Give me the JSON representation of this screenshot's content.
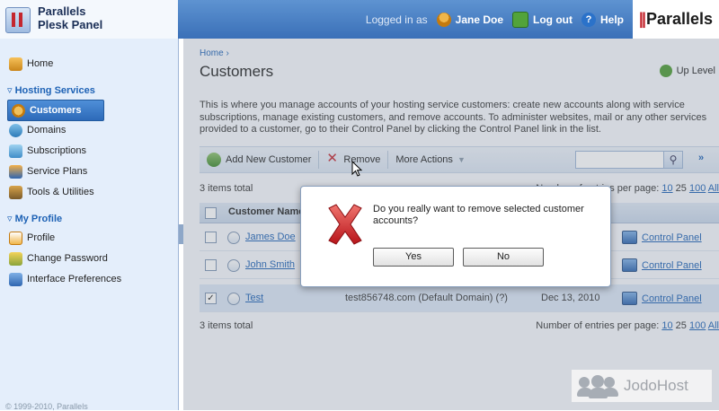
{
  "header": {
    "logo_line1": "Parallels",
    "logo_line2": "Plesk Panel",
    "logged_in_as": "Logged in as",
    "user_name": "Jane Doe",
    "logout": "Log out",
    "help": "Help",
    "brand": "Parallels",
    "brand_mark": "||"
  },
  "sidebar": {
    "home": "Home",
    "section_hosting": "Hosting Services",
    "items": [
      {
        "label": "Customers",
        "icon": "customers-icon"
      },
      {
        "label": "Domains",
        "icon": "domains-icon"
      },
      {
        "label": "Subscriptions",
        "icon": "subscriptions-icon"
      },
      {
        "label": "Service Plans",
        "icon": "service-plans-icon"
      },
      {
        "label": "Tools & Utilities",
        "icon": "tools-icon"
      }
    ],
    "section_profile": "My Profile",
    "profile_items": [
      {
        "label": "Profile",
        "icon": "profile-icon"
      },
      {
        "label": "Change Password",
        "icon": "key-icon"
      },
      {
        "label": "Interface Preferences",
        "icon": "interface-icon"
      }
    ],
    "copyright": "© 1999-2010, Parallels"
  },
  "main": {
    "breadcrumb": "Home ›",
    "title": "Customers",
    "up_level": "Up Level",
    "description": "This is where you manage accounts of your hosting service customers: create new accounts along with service subscriptions, manage existing customers, and remove accounts. To administer websites, mail or any other services provided to a customer, go to their Control Panel by clicking the Control Panel link in the list.",
    "toolbar": {
      "add_customer": "Add New Customer",
      "remove": "Remove",
      "more_actions": "More Actions",
      "search_placeholder": ""
    },
    "items_total": "3 items total",
    "per_page_label": "Number of entries per page:",
    "per_page_options": [
      "10",
      "25",
      "100",
      "All"
    ],
    "table": {
      "header_name": "Customer Name",
      "rows": [
        {
          "name": "James Doe",
          "domain": "",
          "date": "",
          "control_panel": "Control Panel",
          "checked": false
        },
        {
          "name": "John Smith",
          "domain": "",
          "date": "",
          "control_panel": "Control Panel",
          "checked": false
        },
        {
          "name": "Test",
          "domain": "test856748.com (Default Domain) (?)",
          "date": "Dec 13, 2010",
          "control_panel": "Control Panel",
          "checked": true
        }
      ]
    }
  },
  "dialog": {
    "message": "Do you really want to remove selected customer accounts?",
    "yes": "Yes",
    "no": "No"
  },
  "watermark": "JodoHost",
  "colors": {
    "header_blue": "#3a70b8",
    "link_blue": "#1e62b5",
    "brand_red": "#c4262e"
  }
}
